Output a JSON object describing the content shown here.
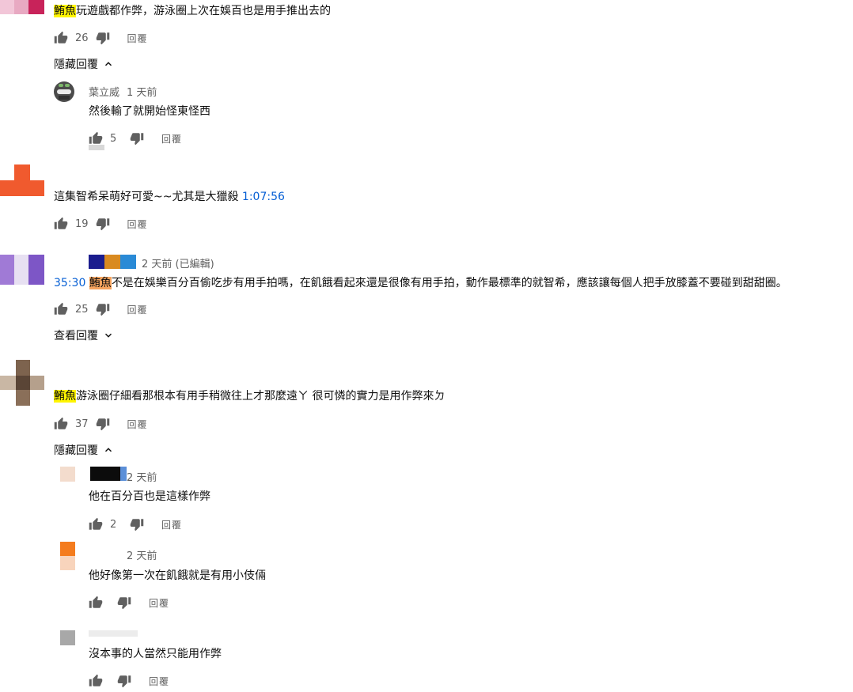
{
  "comments": [
    {
      "tag": "鮪魚",
      "text": "玩遊戲都作弊，游泳圈上次在娛百也是用手推出去的",
      "likes": "26",
      "reply_label": "回覆",
      "toggle_label": "隱藏回覆",
      "toggle_icon": "chevron-up-icon",
      "replies": [
        {
          "author": "葉立威",
          "time": "1 天前",
          "text": "然後輸了就開始怪東怪西",
          "likes": "5",
          "reply_label": "回覆"
        }
      ]
    },
    {
      "text": "這集智希呆萌好可愛~~尤其是大獵殺 ",
      "timestamp": "1:07:56",
      "likes": "19",
      "reply_label": "回覆"
    },
    {
      "time": "2 天前 (已編輯)",
      "timestamp": "35:30",
      "tag": "鮪魚",
      "text": "不是在娛樂百分百偷吃步有用手拍嗎，在飢餓看起來還是很像有用手拍，動作最標準的就智希，應該讓每個人把手放膝蓋不要碰到甜甜圈。",
      "likes": "25",
      "reply_label": "回覆",
      "toggle_label": "查看回覆",
      "toggle_icon": "chevron-down-icon"
    },
    {
      "tag": "鮪魚",
      "text": "游泳圈仔細看那根本有用手稍微往上才那麼遠ㄚ 很可憐的實力是用作弊來ㄉ",
      "likes": "37",
      "reply_label": "回覆",
      "toggle_label": "隱藏回覆",
      "toggle_icon": "chevron-up-icon",
      "replies": [
        {
          "time": "2 天前",
          "text": "他在百分百也是這樣作弊",
          "likes": "2",
          "reply_label": "回覆"
        },
        {
          "time": "2 天前",
          "text": "他好像第一次在飢餓就是有用小伎倆",
          "likes": "",
          "reply_label": "回覆"
        },
        {
          "text": "沒本事的人當然只能用作弊",
          "likes": "",
          "reply_label": "回覆"
        }
      ]
    }
  ],
  "icons": {
    "like": "thumb-up-icon",
    "dislike": "thumb-down-icon"
  },
  "colors": {
    "highlight_yellow": "#fff500",
    "highlight_orange": "#f5a35e",
    "link": "#065fd4",
    "meta": "#606060"
  }
}
